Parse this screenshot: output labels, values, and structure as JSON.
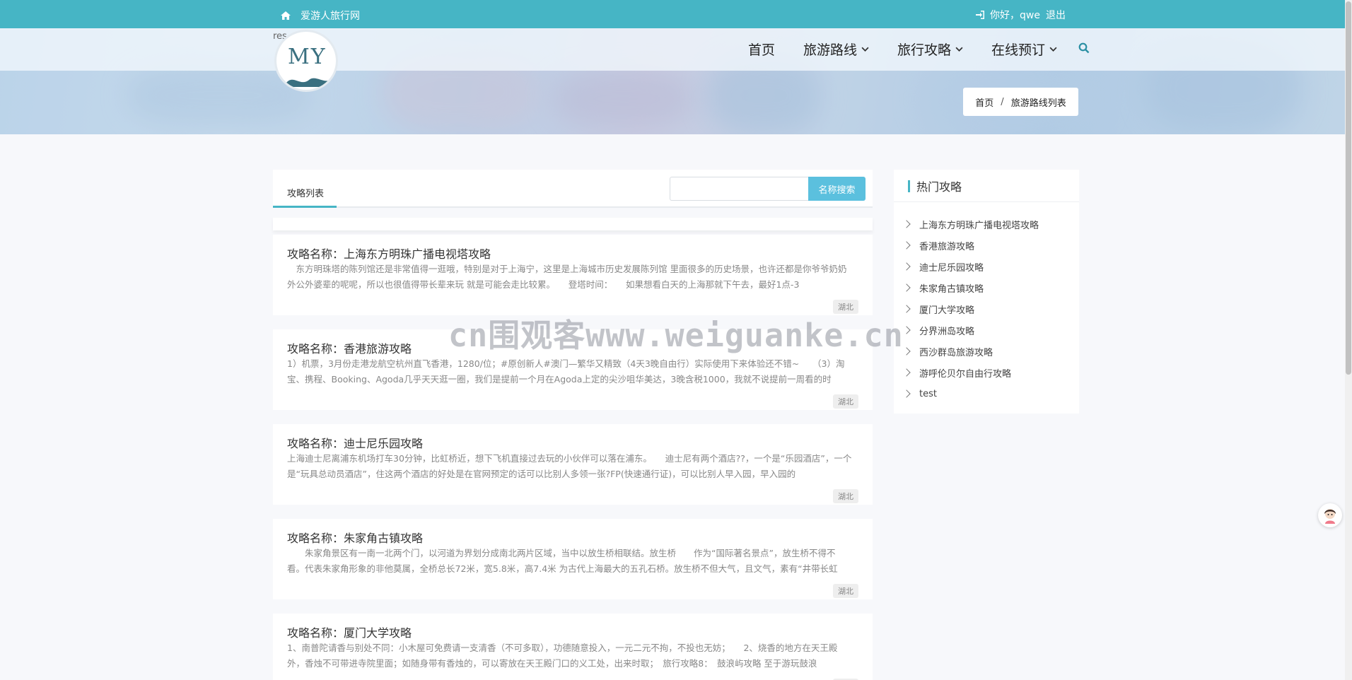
{
  "topbar": {
    "site_name": "爱游人旅行网",
    "greeting": "你好，qwe",
    "logout": "退出",
    "home_icon": "home-icon",
    "login_icon": "sign-in-icon",
    "bg_color": "#46b5c5"
  },
  "header": {
    "logo_text": "MY",
    "logo_stub_text": "res",
    "nav": [
      {
        "label": "首页",
        "has_dropdown": false
      },
      {
        "label": "旅游路线",
        "has_dropdown": true
      },
      {
        "label": "旅行攻略",
        "has_dropdown": true
      },
      {
        "label": "在线预订",
        "has_dropdown": true
      }
    ],
    "search_icon": "search-icon"
  },
  "breadcrumb": {
    "home": "首页",
    "separator": "/",
    "current": "旅游路线列表"
  },
  "list": {
    "tab_label": "攻略列表",
    "search_button": "名称搜索",
    "search_value": "",
    "title_prefix": "攻略名称：",
    "items": [
      {
        "name": "上海东方明珠广播电视塔攻略",
        "desc": "　东方明珠塔的陈列馆还是非常值得一逛哦，特别是对于上海宁，这里是上海城市历史发展陈列馆 里面很多的历史场景，也许还都是你爷爷奶奶外公外婆辈的呢呢，所以也很值得带长辈来玩 就是可能会走比较累。　　登塔时间：　　如果想看白天的上海那就下午去，最好1点-3",
        "tag": "湖北"
      },
      {
        "name": "香港旅游攻略",
        "desc": "1）机票，3月份走港龙航空杭州直飞香港，1280/位；#原创新人#澳门—繁华又精致（4天3晚自由行）实际使用下来体验还不错~　　（3）淘宝、携程、Booking、Agoda几乎天天逛一圈，我们是提前一个月在Agoda上定的尖沙咀华美达，3晚含税1000，我就不说提前一周看的时",
        "tag": "湖北"
      },
      {
        "name": "迪士尼乐园攻略",
        "desc": "上海迪士尼离浦东机场打车30分钟，比虹桥近，想下飞机直接过去玩的小伙伴可以落在浦东。　　迪士尼有两个酒店??，一个是“乐园酒店”，一个是“玩具总动员酒店”，住这两个酒店的好处是在官网预定的话可以比别人多领一张?FP(快速通行证)，可以比别人早入园，早入园的",
        "tag": "湖北"
      },
      {
        "name": "朱家角古镇攻略",
        "desc": "　　朱家角景区有一南一北两个门，以河道为界划分成南北两片区域，当中以放生桥相联结。放生桥　　作为“国际著名景点”，放生桥不得不看。代表朱家角形象的非他莫属，全桥总长72米，宽5.8米，高7.4米 为古代上海最大的五孔石桥。放生桥不但大气，且文气，素有“井带长虹",
        "tag": "湖北"
      },
      {
        "name": "厦门大学攻略",
        "desc": "1、南普陀请香与别处不同：小木屋可免费请一支清香（不可多取），功德随意投入，一元二元不拘，不投也无妨；　　2、烧香的地方在天王殿外，香烛不可带进寺院里面；如随身带有香烛的，可以寄放在天王殿门口的义工处，出来时取；　旅行攻略8：　鼓浪屿攻略 至于游玩鼓浪",
        "tag": "湖北"
      }
    ]
  },
  "sidebar": {
    "title": "热门攻略",
    "items": [
      "上海东方明珠广播电视塔攻略",
      "香港旅游攻略",
      "迪士尼乐园攻略",
      "朱家角古镇攻略",
      "厦门大学攻略",
      "分界洲岛攻略",
      "西沙群岛旅游攻略",
      "游呼伦贝尔自由行攻略",
      "test"
    ]
  },
  "watermark": "cn围观客www.weiguanke.cn"
}
